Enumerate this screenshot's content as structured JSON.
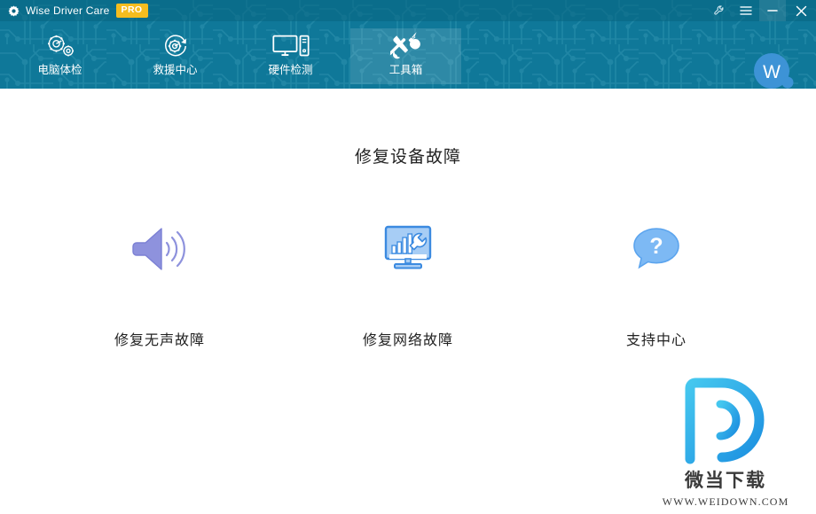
{
  "window": {
    "app_title": "Wise Driver Care",
    "pro_badge": "PRO",
    "brand_icon": "gear-icon",
    "controls": [
      {
        "name": "settings-wrench-icon",
        "tooltip": "Settings"
      },
      {
        "name": "menu-hamburger-icon",
        "tooltip": "Menu"
      },
      {
        "name": "minimize-icon",
        "tooltip": "Minimize"
      },
      {
        "name": "close-icon",
        "tooltip": "Close"
      }
    ],
    "theme": {
      "header_bg": "#0f7899",
      "titlebar_bg": "#0a6480",
      "pro_badge_bg": "#f5bd1f",
      "body_bg": "#ffffff"
    }
  },
  "nav": {
    "tabs": [
      {
        "label": "电脑体检",
        "icon": "gears-checkup-icon",
        "active": false
      },
      {
        "label": "救援中心",
        "icon": "gear-refresh-icon",
        "active": false
      },
      {
        "label": "硬件检测",
        "icon": "monitor-pc-icon",
        "active": false
      },
      {
        "label": "工具箱",
        "icon": "wrench-screwdriver-icon",
        "active": true
      }
    ],
    "avatar": {
      "letter": "W",
      "name": "user-avatar",
      "color": "#3d93d6"
    }
  },
  "main": {
    "title": "修复设备故障",
    "features": [
      {
        "label": "修复无声故障",
        "icon": "speaker-sound-icon",
        "color": "#8b8fd8"
      },
      {
        "label": "修复网络故障",
        "icon": "monitor-network-wrench-icon",
        "color": "#4a9ae8"
      },
      {
        "label": "支持中心",
        "icon": "question-bubble-icon",
        "color": "#77b5f2"
      }
    ]
  },
  "watermark": {
    "logo": "weidown-d-logo",
    "title_cn": "微当下载",
    "url": "WWW.WEIDOWN.COM"
  }
}
